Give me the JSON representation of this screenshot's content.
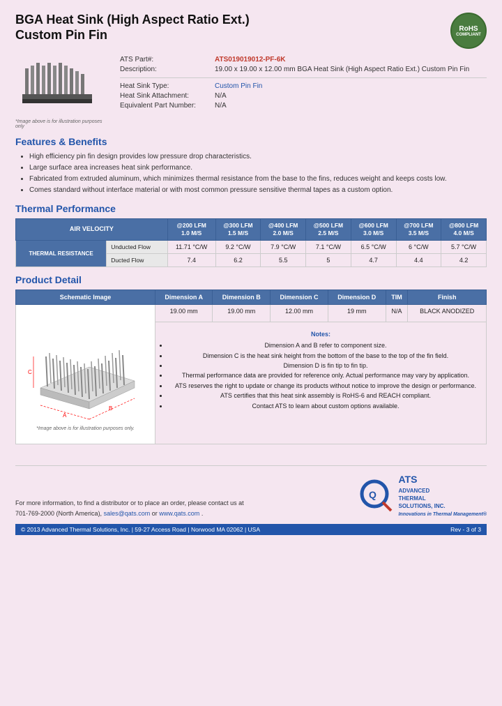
{
  "header": {
    "title_line1": "BGA Heat Sink (High Aspect Ratio Ext.)",
    "title_line2": "Custom Pin Fin",
    "rohs": "RoHS\nCOMPLIANT"
  },
  "product_info": {
    "ats_part_label": "ATS Part#:",
    "ats_part_value": "ATS019019012-PF-6K",
    "description_label": "Description:",
    "description_value": "19.00 x 19.00 x 12.00 mm BGA Heat Sink (High Aspect Ratio Ext.) Custom Pin Fin",
    "heat_sink_type_label": "Heat Sink Type:",
    "heat_sink_type_value": "Custom Pin Fin",
    "attachment_label": "Heat Sink Attachment:",
    "attachment_value": "N/A",
    "equivalent_label": "Equivalent Part Number:",
    "equivalent_value": "N/A",
    "image_caption": "*Image above is for illustration purposes only"
  },
  "features": {
    "heading": "Features & Benefits",
    "items": [
      "High efficiency pin fin design provides low pressure drop characteristics.",
      "Large surface area increases heat sink performance.",
      "Fabricated from extruded aluminum, which minimizes thermal resistance from the base to the fins, reduces weight and keeps costs low.",
      "Comes standard without interface material or with most common pressure sensitive thermal tapes as a custom option."
    ]
  },
  "thermal_performance": {
    "heading": "Thermal Performance",
    "air_velocity_label": "AIR VELOCITY",
    "columns": [
      {
        "label": "@200 LFM",
        "sub": "1.0 M/S"
      },
      {
        "label": "@300 LFM",
        "sub": "1.5 M/S"
      },
      {
        "label": "@400 LFM",
        "sub": "2.0 M/S"
      },
      {
        "label": "@500 LFM",
        "sub": "2.5 M/S"
      },
      {
        "label": "@600 LFM",
        "sub": "3.0 M/S"
      },
      {
        "label": "@700 LFM",
        "sub": "3.5 M/S"
      },
      {
        "label": "@800 LFM",
        "sub": "4.0 M/S"
      }
    ],
    "row_header": "THERMAL RESISTANCE",
    "rows": [
      {
        "label": "Unducted Flow",
        "values": [
          "11.71 °C/W",
          "9.2 °C/W",
          "7.9 °C/W",
          "7.1 °C/W",
          "6.5 °C/W",
          "6 °C/W",
          "5.7 °C/W"
        ]
      },
      {
        "label": "Ducted Flow",
        "values": [
          "7.4",
          "6.2",
          "5.5",
          "5",
          "4.7",
          "4.4",
          "4.2"
        ]
      }
    ]
  },
  "product_detail": {
    "heading": "Product Detail",
    "columns": [
      "Schematic Image",
      "Dimension A",
      "Dimension B",
      "Dimension C",
      "Dimension D",
      "TIM",
      "Finish"
    ],
    "dim_values": [
      "19.00 mm",
      "19.00 mm",
      "12.00 mm",
      "19 mm",
      "N/A",
      "BLACK ANODIZED"
    ],
    "schematic_caption": "*Image above is for illustration purposes only.",
    "notes_heading": "Notes:",
    "notes": [
      "Dimension A and B refer to component size.",
      "Dimension C is the heat sink height from the bottom of the base to the top of the fin field.",
      "Dimension D is fin tip to fin tip.",
      "Thermal performance data are provided for reference only. Actual performance may vary by application.",
      "ATS reserves the right to update or change its products without notice to improve the design or performance.",
      "ATS certifies that this heat sink assembly is RoHS-6 and REACH compliant.",
      "Contact ATS to learn about custom options available."
    ]
  },
  "footer": {
    "contact_text": "For more information, to find a distributor or to place an order, please contact us at\n701-769-2000 (North America), sales@qats.com or www.qats.com.",
    "email": "sales@qats.com",
    "website": "www.qats.com",
    "copyright": "© 2013 Advanced Thermal Solutions, Inc.  |  59-27 Access Road  |  Norwood MA  02062  |  USA",
    "page_num": "Rev - 3 of 3",
    "ats_brand_lines": [
      "ADVANCED",
      "THERMAL",
      "SOLUTIONS, INC.",
      "Innovations in Thermal Management®"
    ]
  }
}
